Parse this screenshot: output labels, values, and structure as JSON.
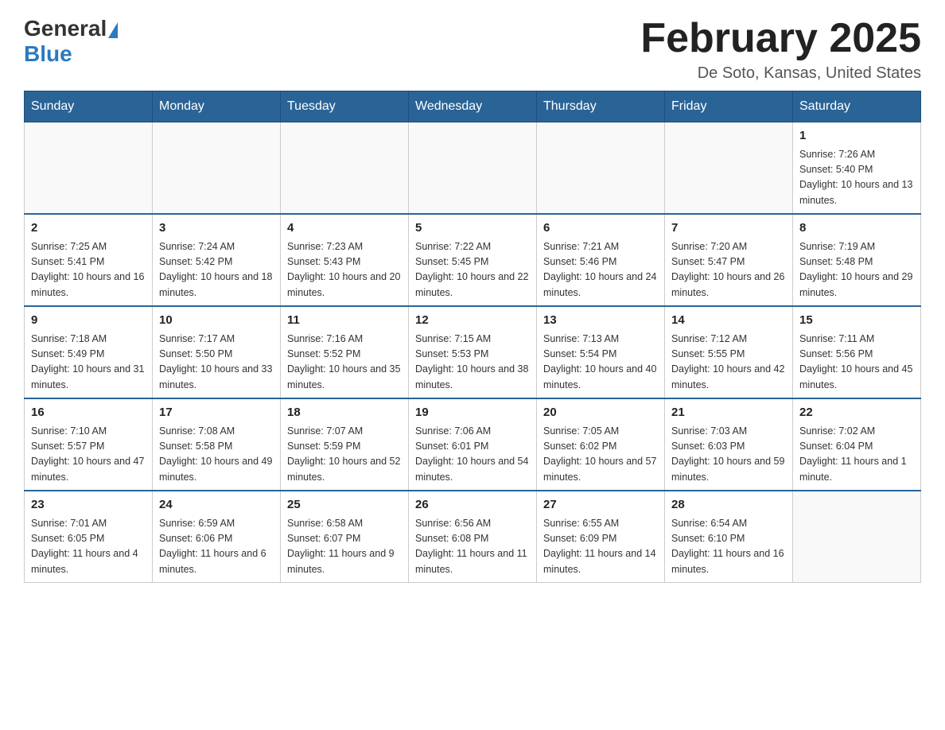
{
  "header": {
    "logo_general": "General",
    "logo_blue": "Blue",
    "month_title": "February 2025",
    "location": "De Soto, Kansas, United States"
  },
  "weekdays": [
    "Sunday",
    "Monday",
    "Tuesday",
    "Wednesday",
    "Thursday",
    "Friday",
    "Saturday"
  ],
  "weeks": [
    [
      {
        "day": "",
        "info": ""
      },
      {
        "day": "",
        "info": ""
      },
      {
        "day": "",
        "info": ""
      },
      {
        "day": "",
        "info": ""
      },
      {
        "day": "",
        "info": ""
      },
      {
        "day": "",
        "info": ""
      },
      {
        "day": "1",
        "info": "Sunrise: 7:26 AM\nSunset: 5:40 PM\nDaylight: 10 hours and 13 minutes."
      }
    ],
    [
      {
        "day": "2",
        "info": "Sunrise: 7:25 AM\nSunset: 5:41 PM\nDaylight: 10 hours and 16 minutes."
      },
      {
        "day": "3",
        "info": "Sunrise: 7:24 AM\nSunset: 5:42 PM\nDaylight: 10 hours and 18 minutes."
      },
      {
        "day": "4",
        "info": "Sunrise: 7:23 AM\nSunset: 5:43 PM\nDaylight: 10 hours and 20 minutes."
      },
      {
        "day": "5",
        "info": "Sunrise: 7:22 AM\nSunset: 5:45 PM\nDaylight: 10 hours and 22 minutes."
      },
      {
        "day": "6",
        "info": "Sunrise: 7:21 AM\nSunset: 5:46 PM\nDaylight: 10 hours and 24 minutes."
      },
      {
        "day": "7",
        "info": "Sunrise: 7:20 AM\nSunset: 5:47 PM\nDaylight: 10 hours and 26 minutes."
      },
      {
        "day": "8",
        "info": "Sunrise: 7:19 AM\nSunset: 5:48 PM\nDaylight: 10 hours and 29 minutes."
      }
    ],
    [
      {
        "day": "9",
        "info": "Sunrise: 7:18 AM\nSunset: 5:49 PM\nDaylight: 10 hours and 31 minutes."
      },
      {
        "day": "10",
        "info": "Sunrise: 7:17 AM\nSunset: 5:50 PM\nDaylight: 10 hours and 33 minutes."
      },
      {
        "day": "11",
        "info": "Sunrise: 7:16 AM\nSunset: 5:52 PM\nDaylight: 10 hours and 35 minutes."
      },
      {
        "day": "12",
        "info": "Sunrise: 7:15 AM\nSunset: 5:53 PM\nDaylight: 10 hours and 38 minutes."
      },
      {
        "day": "13",
        "info": "Sunrise: 7:13 AM\nSunset: 5:54 PM\nDaylight: 10 hours and 40 minutes."
      },
      {
        "day": "14",
        "info": "Sunrise: 7:12 AM\nSunset: 5:55 PM\nDaylight: 10 hours and 42 minutes."
      },
      {
        "day": "15",
        "info": "Sunrise: 7:11 AM\nSunset: 5:56 PM\nDaylight: 10 hours and 45 minutes."
      }
    ],
    [
      {
        "day": "16",
        "info": "Sunrise: 7:10 AM\nSunset: 5:57 PM\nDaylight: 10 hours and 47 minutes."
      },
      {
        "day": "17",
        "info": "Sunrise: 7:08 AM\nSunset: 5:58 PM\nDaylight: 10 hours and 49 minutes."
      },
      {
        "day": "18",
        "info": "Sunrise: 7:07 AM\nSunset: 5:59 PM\nDaylight: 10 hours and 52 minutes."
      },
      {
        "day": "19",
        "info": "Sunrise: 7:06 AM\nSunset: 6:01 PM\nDaylight: 10 hours and 54 minutes."
      },
      {
        "day": "20",
        "info": "Sunrise: 7:05 AM\nSunset: 6:02 PM\nDaylight: 10 hours and 57 minutes."
      },
      {
        "day": "21",
        "info": "Sunrise: 7:03 AM\nSunset: 6:03 PM\nDaylight: 10 hours and 59 minutes."
      },
      {
        "day": "22",
        "info": "Sunrise: 7:02 AM\nSunset: 6:04 PM\nDaylight: 11 hours and 1 minute."
      }
    ],
    [
      {
        "day": "23",
        "info": "Sunrise: 7:01 AM\nSunset: 6:05 PM\nDaylight: 11 hours and 4 minutes."
      },
      {
        "day": "24",
        "info": "Sunrise: 6:59 AM\nSunset: 6:06 PM\nDaylight: 11 hours and 6 minutes."
      },
      {
        "day": "25",
        "info": "Sunrise: 6:58 AM\nSunset: 6:07 PM\nDaylight: 11 hours and 9 minutes."
      },
      {
        "day": "26",
        "info": "Sunrise: 6:56 AM\nSunset: 6:08 PM\nDaylight: 11 hours and 11 minutes."
      },
      {
        "day": "27",
        "info": "Sunrise: 6:55 AM\nSunset: 6:09 PM\nDaylight: 11 hours and 14 minutes."
      },
      {
        "day": "28",
        "info": "Sunrise: 6:54 AM\nSunset: 6:10 PM\nDaylight: 11 hours and 16 minutes."
      },
      {
        "day": "",
        "info": ""
      }
    ]
  ]
}
